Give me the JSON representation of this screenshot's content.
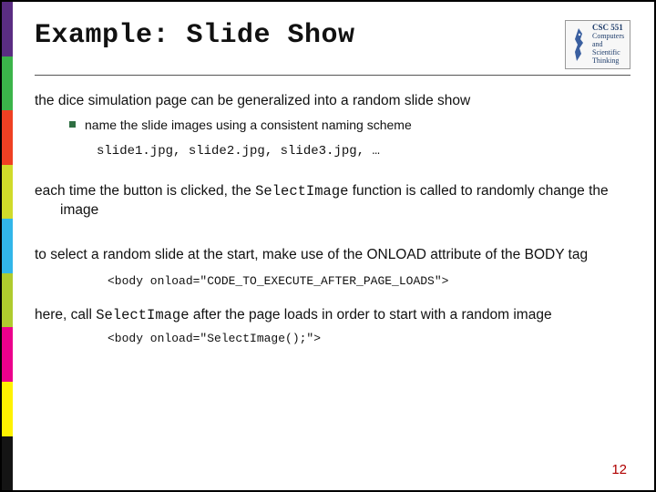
{
  "header": {
    "title": "Example: Slide Show",
    "logo": {
      "course": "CSC 551",
      "line2": "Computers",
      "line3": "and",
      "line4": "Scientific",
      "line5": "Thinking"
    }
  },
  "body": {
    "p1": "the dice simulation page can be generalized into a random slide show",
    "sub1": "name the slide images using a consistent naming scheme",
    "code1": "slide1.jpg, slide2.jpg, slide3.jpg, …",
    "p2a": "each time the button is clicked, the ",
    "p2code": "SelectImage",
    "p2b": " function is called to randomly change the image",
    "p3": "to select a random slide at the start, make use of the ONLOAD attribute of the BODY tag",
    "code2": "<body onload=\"CODE_TO_EXECUTE_AFTER_PAGE_LOADS\">",
    "p4a": "here, call ",
    "p4code": "SelectImage",
    "p4b": " after the page loads in order to start with a random image",
    "code3": "<body onload=\"SelectImage();\">"
  },
  "page_number": "12"
}
